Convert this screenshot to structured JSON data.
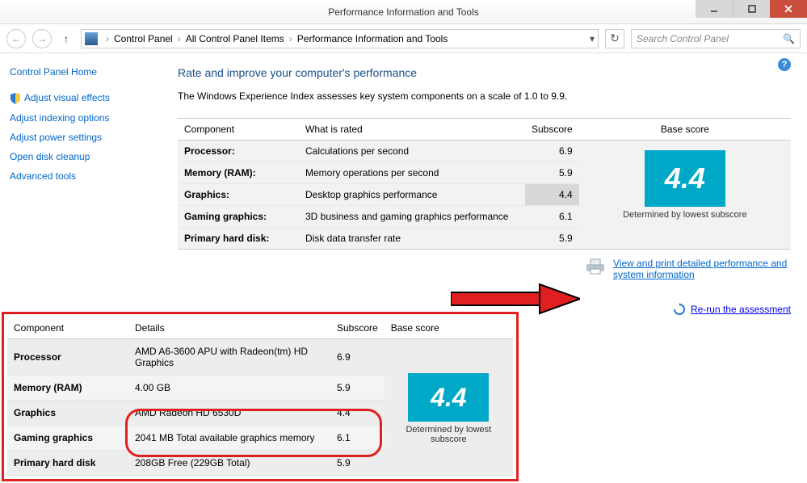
{
  "window": {
    "title": "Performance Information and Tools"
  },
  "breadcrumb": {
    "items": [
      "Control Panel",
      "All Control Panel Items",
      "Performance Information and Tools"
    ]
  },
  "search": {
    "placeholder": "Search Control Panel"
  },
  "sidebar": {
    "home": "Control Panel Home",
    "links": [
      "Adjust visual effects",
      "Adjust indexing options",
      "Adjust power settings",
      "Open disk cleanup",
      "Advanced tools"
    ]
  },
  "content": {
    "heading": "Rate and improve your computer's performance",
    "description": "The Windows Experience Index assesses key system components on a scale of 1.0 to 9.9.",
    "headers": {
      "component": "Component",
      "rated": "What is rated",
      "subscore": "Subscore",
      "basescore": "Base score"
    },
    "rows": [
      {
        "component": "Processor:",
        "rated": "Calculations per second",
        "subscore": "6.9",
        "highlight": false
      },
      {
        "component": "Memory (RAM):",
        "rated": "Memory operations per second",
        "subscore": "5.9",
        "highlight": false
      },
      {
        "component": "Graphics:",
        "rated": "Desktop graphics performance",
        "subscore": "4.4",
        "highlight": true
      },
      {
        "component": "Gaming graphics:",
        "rated": "3D business and gaming graphics performance",
        "subscore": "6.1",
        "highlight": false
      },
      {
        "component": "Primary hard disk:",
        "rated": "Disk data transfer rate",
        "subscore": "5.9",
        "highlight": false
      }
    ],
    "base_score": "4.4",
    "base_caption": "Determined by lowest subscore",
    "view_print_link": "View and print detailed performance and system information",
    "rerun_link": "Re-run the assessment"
  },
  "detail_panel": {
    "headers": {
      "component": "Component",
      "details": "Details",
      "subscore": "Subscore",
      "basescore": "Base score"
    },
    "rows": [
      {
        "component": "Processor",
        "details": "AMD A6-3600 APU with Radeon(tm) HD Graphics",
        "subscore": "6.9"
      },
      {
        "component": "Memory (RAM)",
        "details": "4.00 GB",
        "subscore": "5.9"
      },
      {
        "component": "Graphics",
        "details": "AMD Radeon HD 6530D",
        "subscore": "4.4"
      },
      {
        "component": "Gaming graphics",
        "details": "2041 MB Total available graphics memory",
        "subscore": "6.1"
      },
      {
        "component": "Primary hard disk",
        "details": "208GB Free (229GB Total)",
        "subscore": "5.9"
      }
    ],
    "base_score": "4.4",
    "base_caption": "Determined by lowest subscore"
  }
}
